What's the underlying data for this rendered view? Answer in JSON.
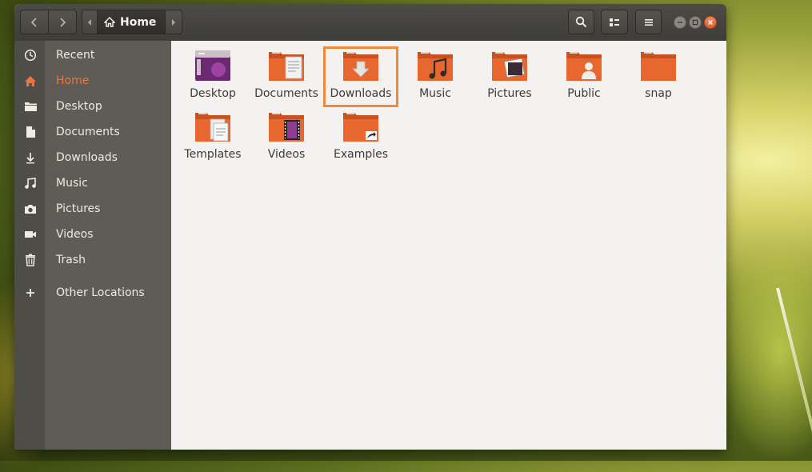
{
  "titlebar": {
    "location_label": "Home"
  },
  "sidebar": {
    "items": [
      {
        "label": "Recent",
        "icon": "clock-icon"
      },
      {
        "label": "Home",
        "icon": "home-icon",
        "active": true
      },
      {
        "label": "Desktop",
        "icon": "folder-icon"
      },
      {
        "label": "Documents",
        "icon": "document-icon"
      },
      {
        "label": "Downloads",
        "icon": "download-icon"
      },
      {
        "label": "Music",
        "icon": "music-icon"
      },
      {
        "label": "Pictures",
        "icon": "camera-icon"
      },
      {
        "label": "Videos",
        "icon": "video-icon"
      },
      {
        "label": "Trash",
        "icon": "trash-icon"
      },
      {
        "label": "Other Locations",
        "icon": "plus-icon"
      }
    ]
  },
  "files": [
    {
      "label": "Desktop",
      "icon": "desktop-folder-icon"
    },
    {
      "label": "Documents",
      "icon": "documents-folder-icon"
    },
    {
      "label": "Downloads",
      "icon": "downloads-folder-icon",
      "selected": true
    },
    {
      "label": "Music",
      "icon": "music-folder-icon"
    },
    {
      "label": "Pictures",
      "icon": "pictures-folder-icon"
    },
    {
      "label": "Public",
      "icon": "public-folder-icon"
    },
    {
      "label": "snap",
      "icon": "folder-icon"
    },
    {
      "label": "Templates",
      "icon": "templates-folder-icon"
    },
    {
      "label": "Videos",
      "icon": "videos-folder-icon"
    },
    {
      "label": "Examples",
      "icon": "examples-folder-icon"
    }
  ],
  "colors": {
    "accent": "#e9753f",
    "folder": "#e8672f",
    "selection_outline": "#f08a3a"
  }
}
